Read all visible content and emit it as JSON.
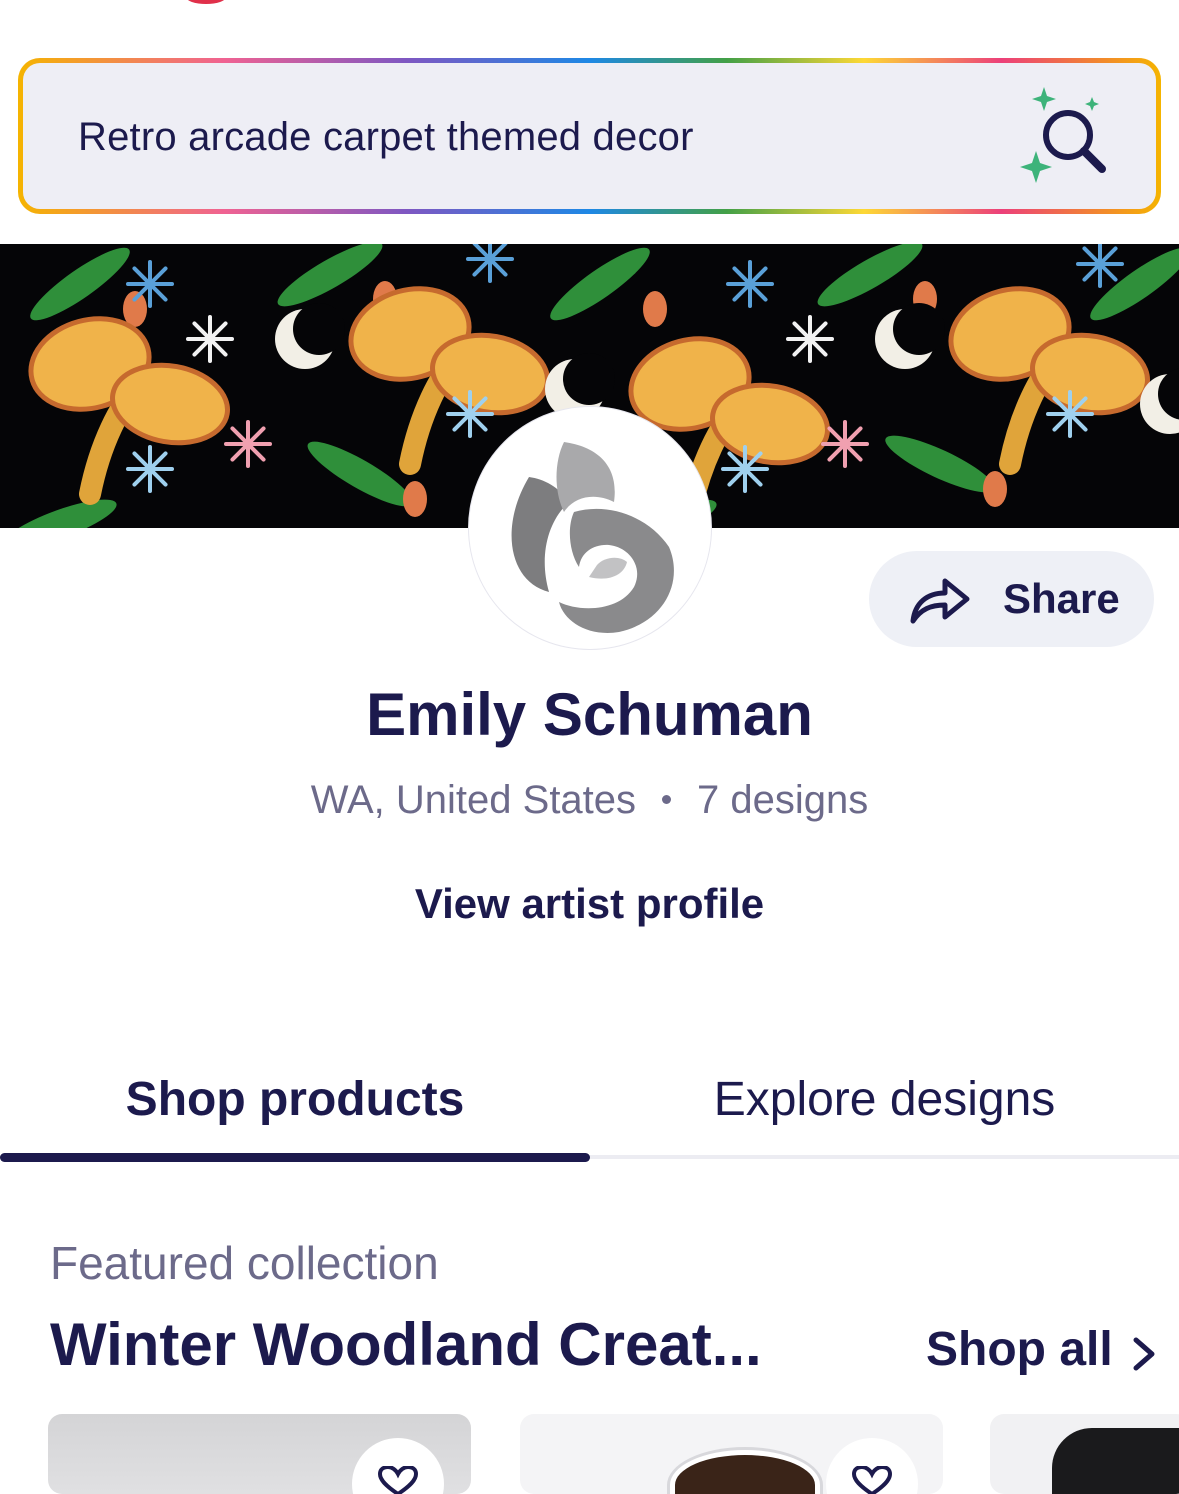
{
  "search": {
    "value": "Retro arcade carpet themed decor"
  },
  "actions": {
    "share_label": "Share"
  },
  "artist": {
    "name": "Emily Schuman",
    "location": "WA, United States",
    "designs": "7 designs",
    "view_profile": "View artist profile"
  },
  "tabs": [
    {
      "label": "Shop products",
      "active": true
    },
    {
      "label": "Explore designs",
      "active": false
    }
  ],
  "featured": {
    "label": "Featured collection",
    "title": "Winter Woodland Creat...",
    "shop_all": "Shop all"
  },
  "icons": {
    "search": "sparkle-search-icon",
    "share": "share-arrow-icon",
    "chevron": "chevron-right-icon",
    "favorite": "heart-icon"
  },
  "colors": {
    "primary": "#1c1a4d",
    "muted": "#6c6a8a",
    "search_bg": "#eeeef5",
    "share_bg": "#eef0f6",
    "sparkle": "#3db37a"
  }
}
